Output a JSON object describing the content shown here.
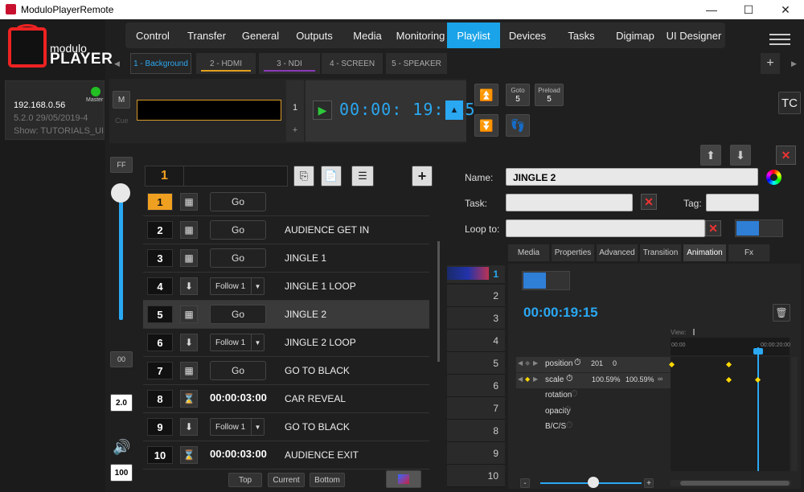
{
  "window": {
    "title": "ModuloPlayerRemote",
    "minimize": "—",
    "maximize": "☐",
    "close": "✕"
  },
  "logo": {
    "top": "modulo",
    "bottom": "PLAYER"
  },
  "device": {
    "ip": "192.168.0.56",
    "role": "Master",
    "version": "5.2.0 29/05/2019-4",
    "show": "Show: TUTORIALS_UI",
    "status_color": "#22c022"
  },
  "nav": {
    "tabs": [
      "Control",
      "Transfer",
      "General",
      "Outputs",
      "Media",
      "Monitoring",
      "Playlist",
      "Devices",
      "Tasks",
      "Digimap",
      "UI Designer"
    ],
    "active": "Playlist"
  },
  "layers": [
    {
      "label": "1 - Background",
      "color": ""
    },
    {
      "label": "2 - HDMI",
      "color": "#e0a020"
    },
    {
      "label": "3 - NDI",
      "color": "#8a3ab9"
    },
    {
      "label": "4 - SCREEN",
      "color": ""
    },
    {
      "label": "5 - SPEAKER",
      "color": ""
    }
  ],
  "layer_add": "+",
  "transport": {
    "m_label": "M",
    "cue_label": "Cue",
    "cue_number": "1",
    "plus": "+",
    "timecode": "00:00: 19: 15",
    "goto_label": "Goto",
    "goto_value": "5",
    "preload_label": "Preload",
    "preload_value": "5",
    "tc_label": "TC"
  },
  "side": {
    "ff": "FF",
    "oo": "00",
    "speed": "2.0",
    "volume": "100",
    "fader_level": 1.0
  },
  "playlist": {
    "current": "1",
    "rows": [
      {
        "num": "1",
        "icon": "checkered-flag",
        "action": "Go",
        "type": "go",
        "label": "",
        "active": true
      },
      {
        "num": "2",
        "icon": "checkered-flag",
        "action": "Go",
        "type": "go",
        "label": "AUDIENCE GET IN"
      },
      {
        "num": "3",
        "icon": "checkered-flag",
        "action": "Go",
        "type": "go",
        "label": "JINGLE 1"
      },
      {
        "num": "4",
        "icon": "arrow-down",
        "action": "Follow 1",
        "type": "follow",
        "label": "JINGLE 1 LOOP"
      },
      {
        "num": "5",
        "icon": "checkered-flag",
        "action": "Go",
        "type": "go",
        "label": "JINGLE 2",
        "selected": true
      },
      {
        "num": "6",
        "icon": "arrow-down",
        "action": "Follow 1",
        "type": "follow",
        "label": "JINGLE 2 LOOP"
      },
      {
        "num": "7",
        "icon": "checkered-flag",
        "action": "Go",
        "type": "go",
        "label": "GO TO BLACK"
      },
      {
        "num": "8",
        "icon": "hourglass",
        "action": "00:00:03:00",
        "type": "time",
        "label": "CAR REVEAL"
      },
      {
        "num": "9",
        "icon": "arrow-down",
        "action": "Follow 1",
        "type": "follow",
        "label": "GO TO BLACK"
      },
      {
        "num": "10",
        "icon": "hourglass",
        "action": "00:00:03:00",
        "type": "time",
        "label": "AUDIENCE EXIT"
      }
    ],
    "footer": {
      "top": "Top",
      "current": "Current",
      "bottom": "Bottom"
    }
  },
  "editor": {
    "name_label": "Name:",
    "name_value": "JINGLE 2",
    "task_label": "Task:",
    "task_value": "",
    "tag_label": "Tag:",
    "tag_value": "",
    "loop_label": "Loop to:",
    "loop_value": "",
    "tabs": [
      "Media",
      "Properties",
      "Advanced",
      "Transition",
      "Animation",
      "Fx"
    ],
    "active_tab": "Animation",
    "anim_time": "00:00:19:15",
    "view_label": "View:",
    "ruler_start": "00:00",
    "ruler_end": "00:00:20:00",
    "properties": [
      {
        "name": "position",
        "values": [
          "201",
          "0"
        ]
      },
      {
        "name": "scale",
        "values": [
          "100.59%",
          "100.59%"
        ]
      },
      {
        "name": "rotation",
        "values": []
      },
      {
        "name": "opacity",
        "values": []
      },
      {
        "name": "B/C/S",
        "values": []
      }
    ],
    "zoom_minus": "-",
    "zoom_plus": "+"
  },
  "layer_rows": [
    "1",
    "2",
    "3",
    "4",
    "5",
    "6",
    "7",
    "8",
    "9",
    "10"
  ],
  "colors": {
    "accent": "#1aa3e8",
    "orange": "#f0a020",
    "red": "#e03030"
  }
}
